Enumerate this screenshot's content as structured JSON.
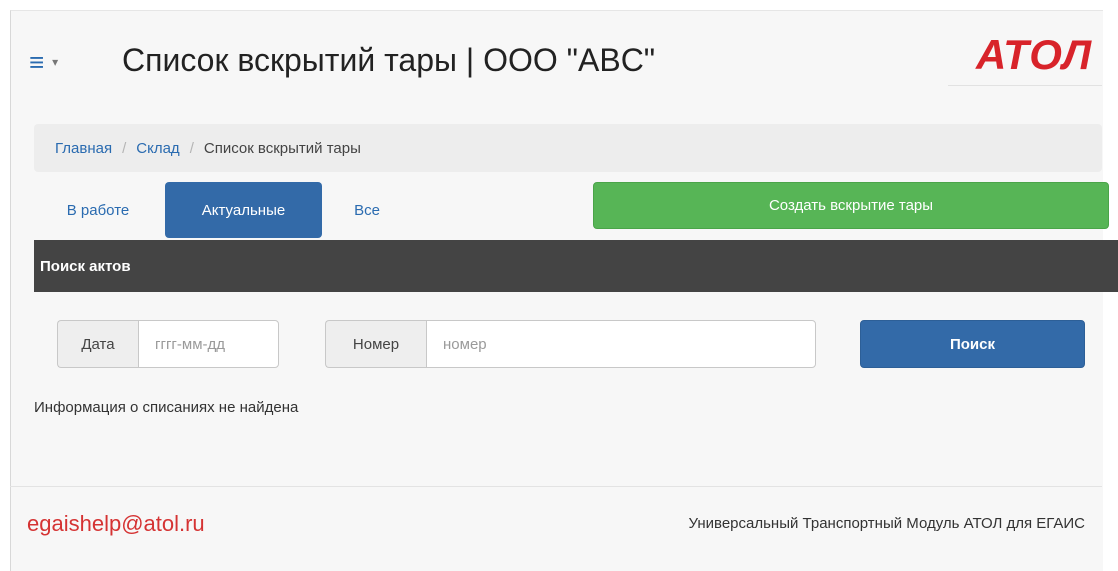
{
  "header": {
    "menu_icon": "hamburger-icon",
    "menu_caret_icon": "caret-down-icon",
    "title": "Список вскрытий тары | ООО \"ABC\"",
    "logo_text": "АТОЛ",
    "logo_color": "#d8232a"
  },
  "breadcrumb": {
    "items": [
      "Главная",
      "Склад"
    ],
    "separator": "/",
    "current": "Список вскрытий тары"
  },
  "tabs": [
    {
      "label": "В работе",
      "active": false
    },
    {
      "label": "Актуальные",
      "active": true
    },
    {
      "label": "Все",
      "active": false
    }
  ],
  "create_button": {
    "label": "Создать вскрытие тары",
    "color": "#57b556"
  },
  "search_panel": {
    "title": "Поиск актов",
    "date_addon": "Дата",
    "date_value": "",
    "date_placeholder": "гггг-мм-дд",
    "number_addon": "Номер",
    "number_value": "",
    "number_placeholder": "номер",
    "search_button": "Поиск"
  },
  "empty_message": "Информация о списаниях не найдена",
  "footer": {
    "email": "egaishelp@atol.ru",
    "product": "Универсальный Транспортный Модуль АТОЛ для ЕГАИС"
  },
  "colors": {
    "primary": "#336aa8",
    "success": "#57b556",
    "panel_header": "#444444",
    "footer_email": "#d53333"
  }
}
